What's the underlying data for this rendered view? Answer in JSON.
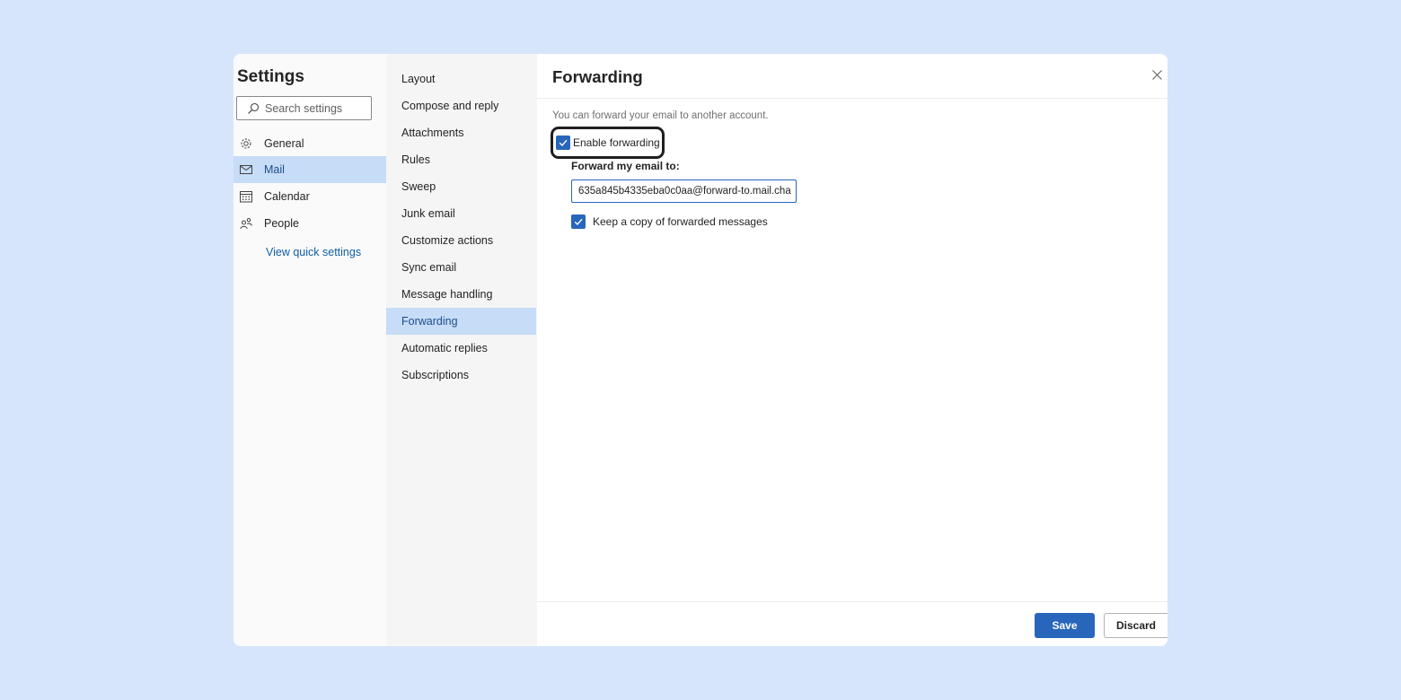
{
  "settings": {
    "title": "Settings",
    "search_placeholder": "Search settings",
    "categories": [
      {
        "label": "General",
        "icon": "gear-icon"
      },
      {
        "label": "Mail",
        "icon": "mail-icon",
        "active": true
      },
      {
        "label": "Calendar",
        "icon": "calendar-icon"
      },
      {
        "label": "People",
        "icon": "people-icon"
      }
    ],
    "quick_settings_link": "View quick settings"
  },
  "mail_sections": [
    {
      "label": "Layout"
    },
    {
      "label": "Compose and reply"
    },
    {
      "label": "Attachments"
    },
    {
      "label": "Rules"
    },
    {
      "label": "Sweep"
    },
    {
      "label": "Junk email"
    },
    {
      "label": "Customize actions"
    },
    {
      "label": "Sync email"
    },
    {
      "label": "Message handling"
    },
    {
      "label": "Forwarding",
      "active": true
    },
    {
      "label": "Automatic replies"
    },
    {
      "label": "Subscriptions"
    }
  ],
  "forwarding": {
    "heading": "Forwarding",
    "description": "You can forward your email to another account.",
    "enable_label": "Enable forwarding",
    "enable_checked": true,
    "forward_to_label": "Forward my email to:",
    "forward_to_value": "635a845b4335eba0c0aa@forward-to.mail.cha",
    "keep_copy_label": "Keep a copy of forwarded messages",
    "keep_copy_checked": true
  },
  "footer": {
    "save_label": "Save",
    "discard_label": "Discard"
  },
  "colors": {
    "accent": "#2866bc",
    "selection": "#c7dcf7",
    "backdrop": "#d6e5fc"
  }
}
